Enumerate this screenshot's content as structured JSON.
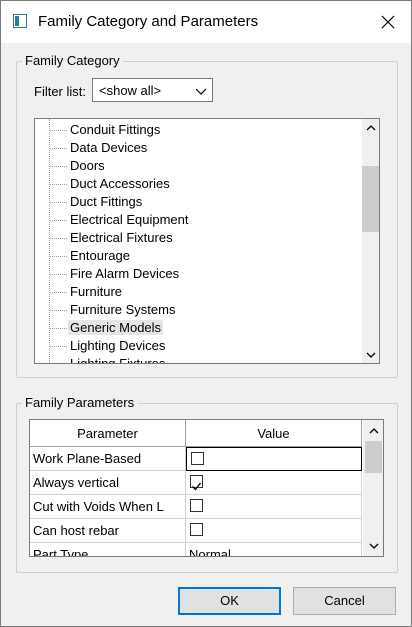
{
  "window": {
    "title": "Family Category and Parameters"
  },
  "category_group": {
    "label": "Family Category",
    "filter_label": "Filter list:",
    "filter_value": "<show all>",
    "items": [
      "Conduit Fittings",
      "Data Devices",
      "Doors",
      "Duct Accessories",
      "Duct Fittings",
      "Electrical Equipment",
      "Electrical Fixtures",
      "Entourage",
      "Fire Alarm Devices",
      "Furniture",
      "Furniture Systems",
      "Generic Models",
      "Lighting Devices",
      "Lighting Fixtures"
    ],
    "selected_item": "Generic Models"
  },
  "parameters_group": {
    "label": "Family Parameters",
    "headers": {
      "parameter": "Parameter",
      "value": "Value"
    },
    "rows": [
      {
        "parameter": "Work Plane-Based",
        "checked": false
      },
      {
        "parameter": "Always vertical",
        "checked": true
      },
      {
        "parameter": "Cut with Voids When L",
        "checked": false
      },
      {
        "parameter": "Can host rebar",
        "checked": false
      },
      {
        "parameter": "Part Type",
        "value": "Normal"
      }
    ]
  },
  "buttons": {
    "ok": "OK",
    "cancel": "Cancel"
  },
  "colors": {
    "focus_border": "#0078d7",
    "selected_bg": "#e5e5e5"
  }
}
